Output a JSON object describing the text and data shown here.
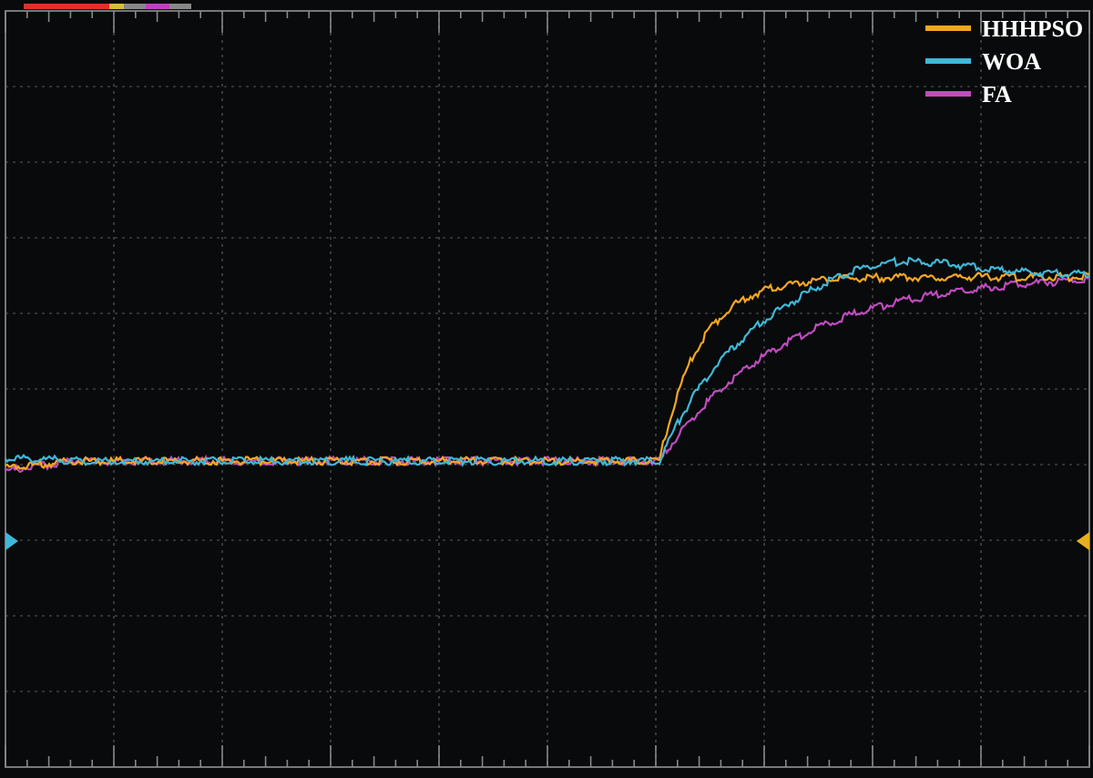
{
  "legend": [
    {
      "label": "HHHPSO",
      "color": "#f5a623"
    },
    {
      "label": "WOA",
      "color": "#3fb8d8"
    },
    {
      "label": "FA",
      "color": "#c04bc0"
    }
  ]
}
